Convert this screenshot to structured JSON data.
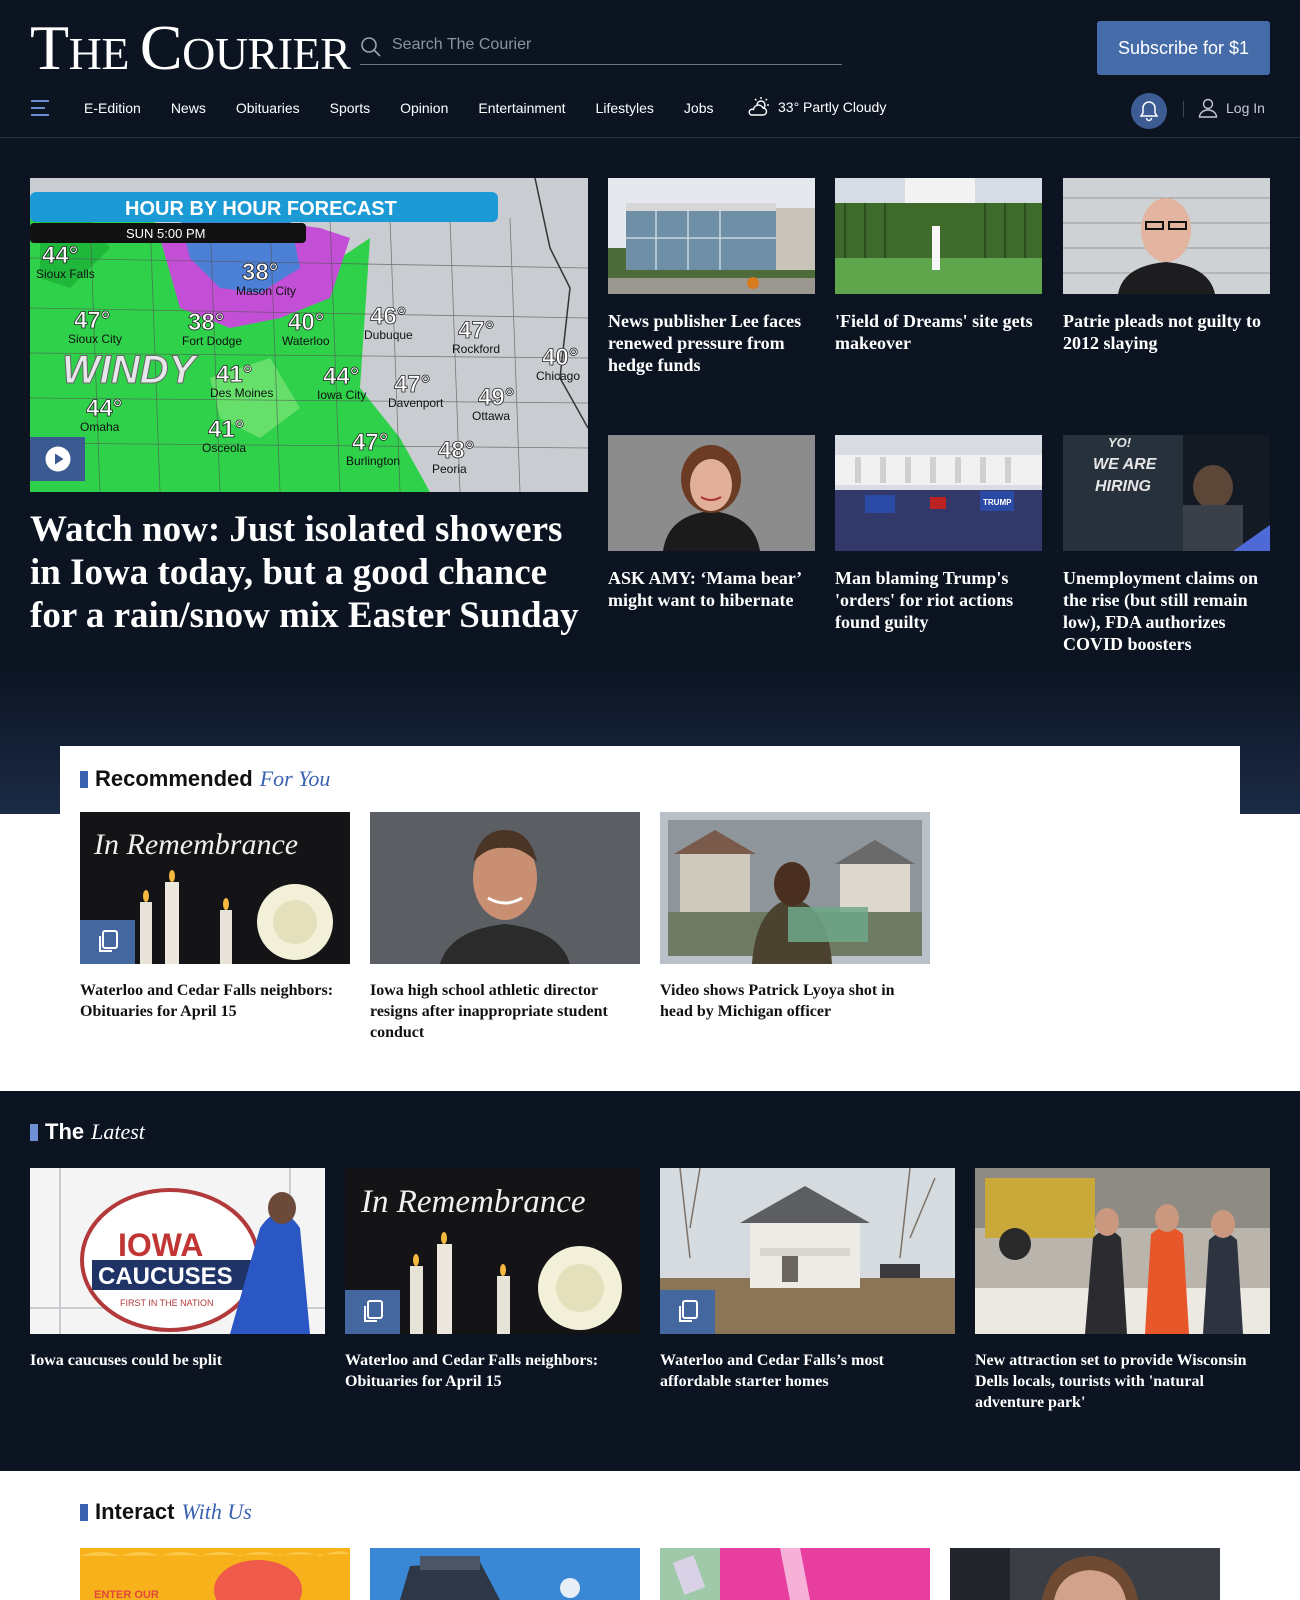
{
  "brand": {
    "logo_big_1": "T",
    "logo_small_1": "HE ",
    "logo_big_2": "C",
    "logo_small_2": "OURIER"
  },
  "search": {
    "placeholder": "Search The Courier"
  },
  "header": {
    "subscribe_label": "Subscribe for $1",
    "login_label": "Log In"
  },
  "nav": {
    "items": [
      "E-Edition",
      "News",
      "Obituaries",
      "Sports",
      "Opinion",
      "Entertainment",
      "Lifestyles",
      "Jobs"
    ]
  },
  "weather": {
    "text": "33° Partly Cloudy"
  },
  "hero": {
    "headline": "Watch now: Just isolated showers in Iowa today, but a good chance for a rain/snow mix Easter Sunday",
    "map": {
      "banner": "HOUR BY HOUR FORECAST",
      "time": "SUN 5:00 PM",
      "windy": "WINDY",
      "temps": [
        {
          "t": "44°",
          "city": "Sioux Falls"
        },
        {
          "t": "38°",
          "city": "Mason City"
        },
        {
          "t": "47°",
          "city": "Sioux City"
        },
        {
          "t": "38°",
          "city": "Fort Dodge"
        },
        {
          "t": "40°",
          "city": "Waterloo"
        },
        {
          "t": "46°",
          "city": "Dubuque"
        },
        {
          "t": "47°",
          "city": "Rockford"
        },
        {
          "t": "40°",
          "city": "Chicago"
        },
        {
          "t": "41°",
          "city": "Des Moines"
        },
        {
          "t": "44°",
          "city": "Iowa City"
        },
        {
          "t": "47°",
          "city": "Davenport"
        },
        {
          "t": "49°",
          "city": "Ottawa"
        },
        {
          "t": "44°",
          "city": "Omaha"
        },
        {
          "t": "41°",
          "city": "Osceola"
        },
        {
          "t": "47°",
          "city": "Burlington"
        },
        {
          "t": "48°",
          "city": "Peoria"
        }
      ]
    }
  },
  "top_stories": [
    {
      "headline": "News publisher Lee faces renewed pressure from hedge funds"
    },
    {
      "headline": "'Field of Dreams' site gets makeover"
    },
    {
      "headline": "Patrie pleads not guilty to 2012 slaying"
    },
    {
      "headline": "ASK AMY: ‘Mama bear’ might want to hibernate"
    },
    {
      "headline": "Man blaming Trump's 'orders' for riot actions found guilty"
    },
    {
      "headline": "Unemployment claims on the rise (but still remain low), FDA authorizes COVID boosters"
    }
  ],
  "thumb_text": {
    "hiring": [
      "YO!",
      "WE ARE",
      "HIRING"
    ],
    "trump": "TRUMP",
    "remembrance": "In Remembrance",
    "iowa": "IOWA",
    "caucuses": "CAUCUSES",
    "first": "FIRST IN THE NATION"
  },
  "recommended": {
    "title_a": "Recommended",
    "title_b": "For You",
    "items": [
      {
        "headline": "Waterloo and Cedar Falls neighbors: Obituaries for April 15"
      },
      {
        "headline": "Iowa high school athletic director resigns after inappropriate student conduct"
      },
      {
        "headline": "Video shows Patrick Lyoya shot in head by Michigan officer"
      }
    ]
  },
  "latest": {
    "title_a": "The",
    "title_b": "Latest",
    "items": [
      {
        "headline": "Iowa caucuses could be split"
      },
      {
        "headline": "Waterloo and Cedar Falls neighbors: Obituaries for April 15"
      },
      {
        "headline": "Waterloo and Cedar Falls’s most affordable starter homes"
      },
      {
        "headline": "New attraction set to provide Wisconsin Dells locals, tourists with 'natural adventure park'"
      }
    ]
  },
  "interact": {
    "title_a": "Interact",
    "title_b": "With Us",
    "promo_text": "ENTER OUR"
  },
  "colors": {
    "header_bg": "#0c1422",
    "accent": "#3a62b0",
    "button": "#456ba8"
  }
}
